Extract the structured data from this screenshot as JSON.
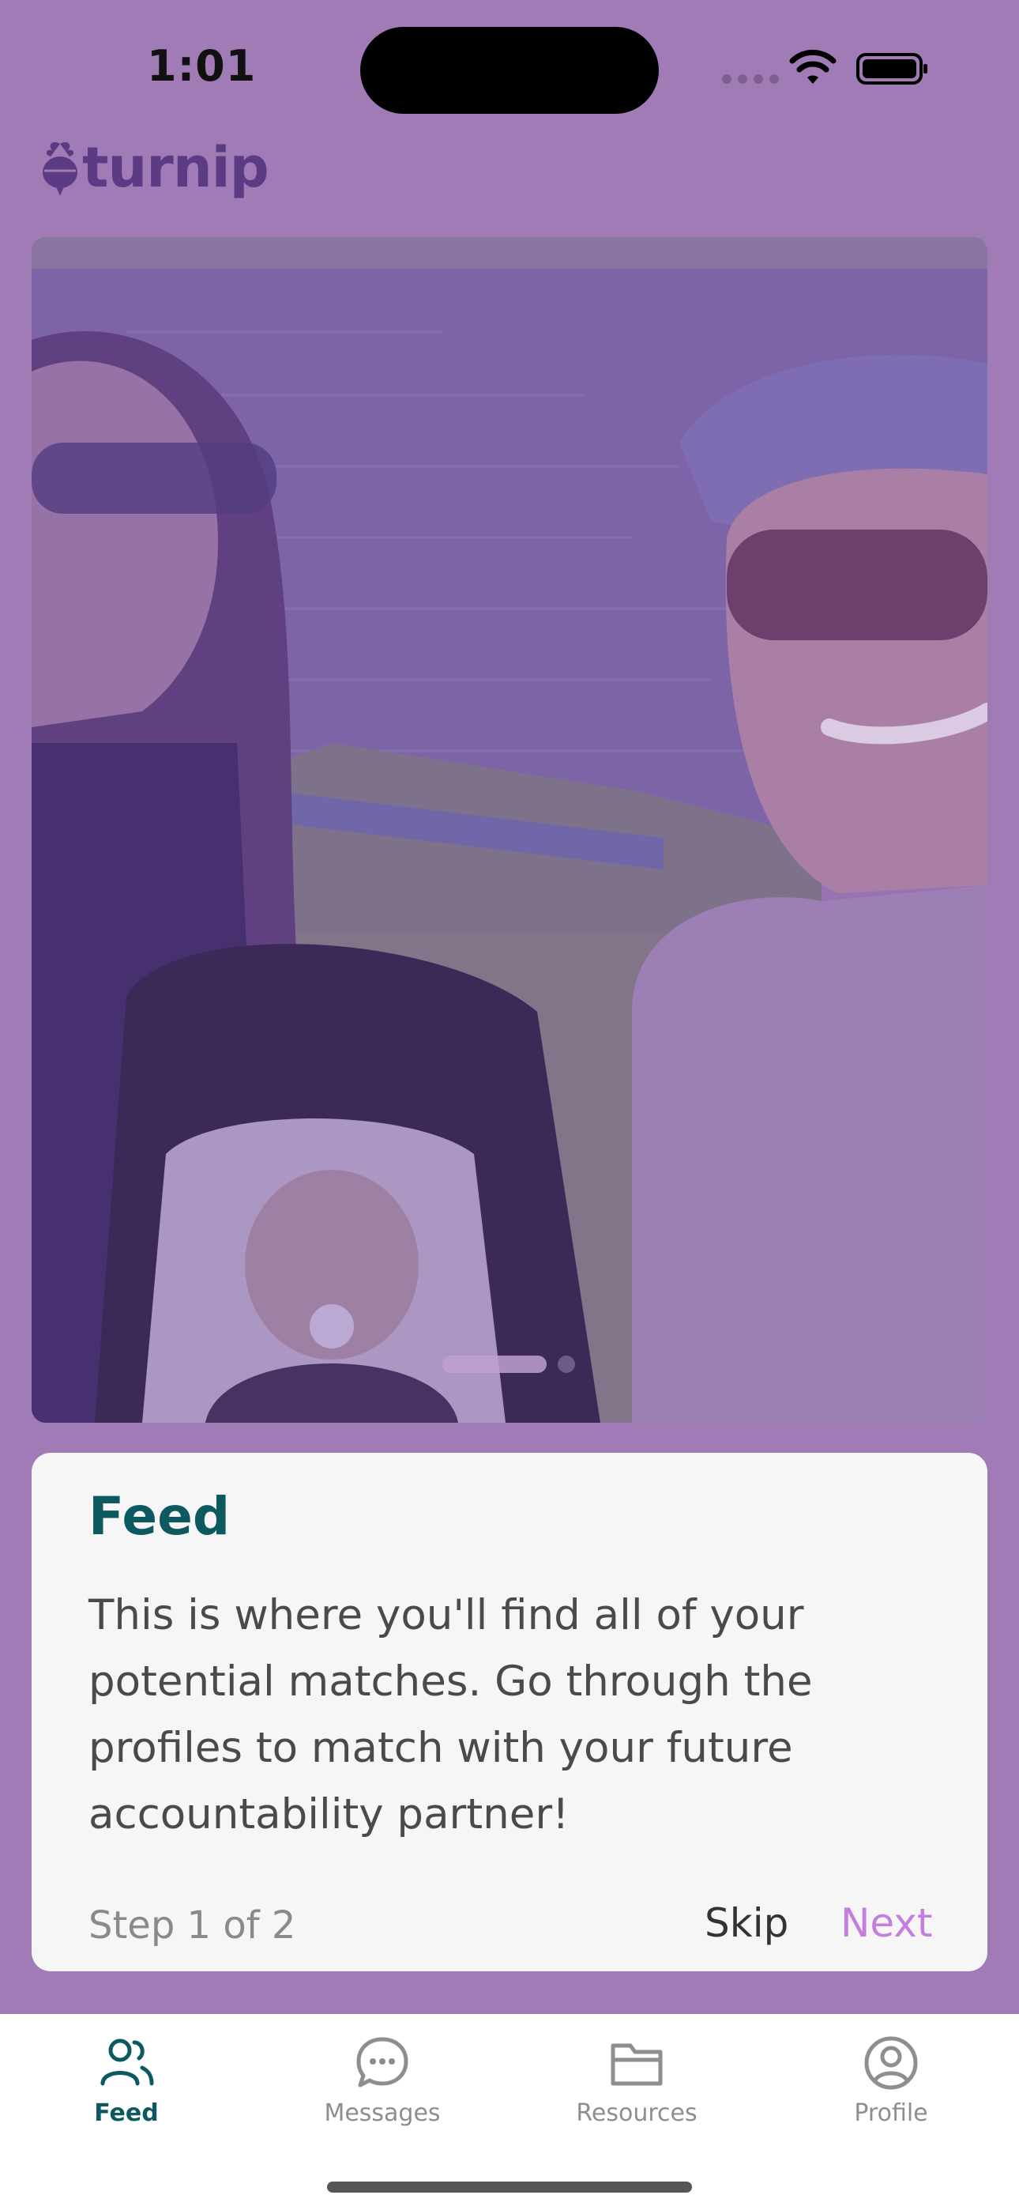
{
  "status_bar": {
    "time": "1:01"
  },
  "app": {
    "logo_text": "turnip",
    "brand_color": "#5B3B84",
    "accent_color": "#A07BB6"
  },
  "photo": {
    "pager_pages": 2,
    "pager_current": 1
  },
  "tour_card": {
    "title": "Feed",
    "body": "This is where you'll find all of your potential matches. Go through the profiles to match with your future accountability partner!",
    "step": "Step 1 of 2",
    "skip_label": "Skip",
    "next_label": "Next"
  },
  "tabs": [
    {
      "label": "Feed",
      "icon": "people-icon",
      "active": true
    },
    {
      "label": "Messages",
      "icon": "chat-bubble-icon",
      "active": false
    },
    {
      "label": "Resources",
      "icon": "folder-icon",
      "active": false
    },
    {
      "label": "Profile",
      "icon": "profile-icon",
      "active": false
    }
  ]
}
